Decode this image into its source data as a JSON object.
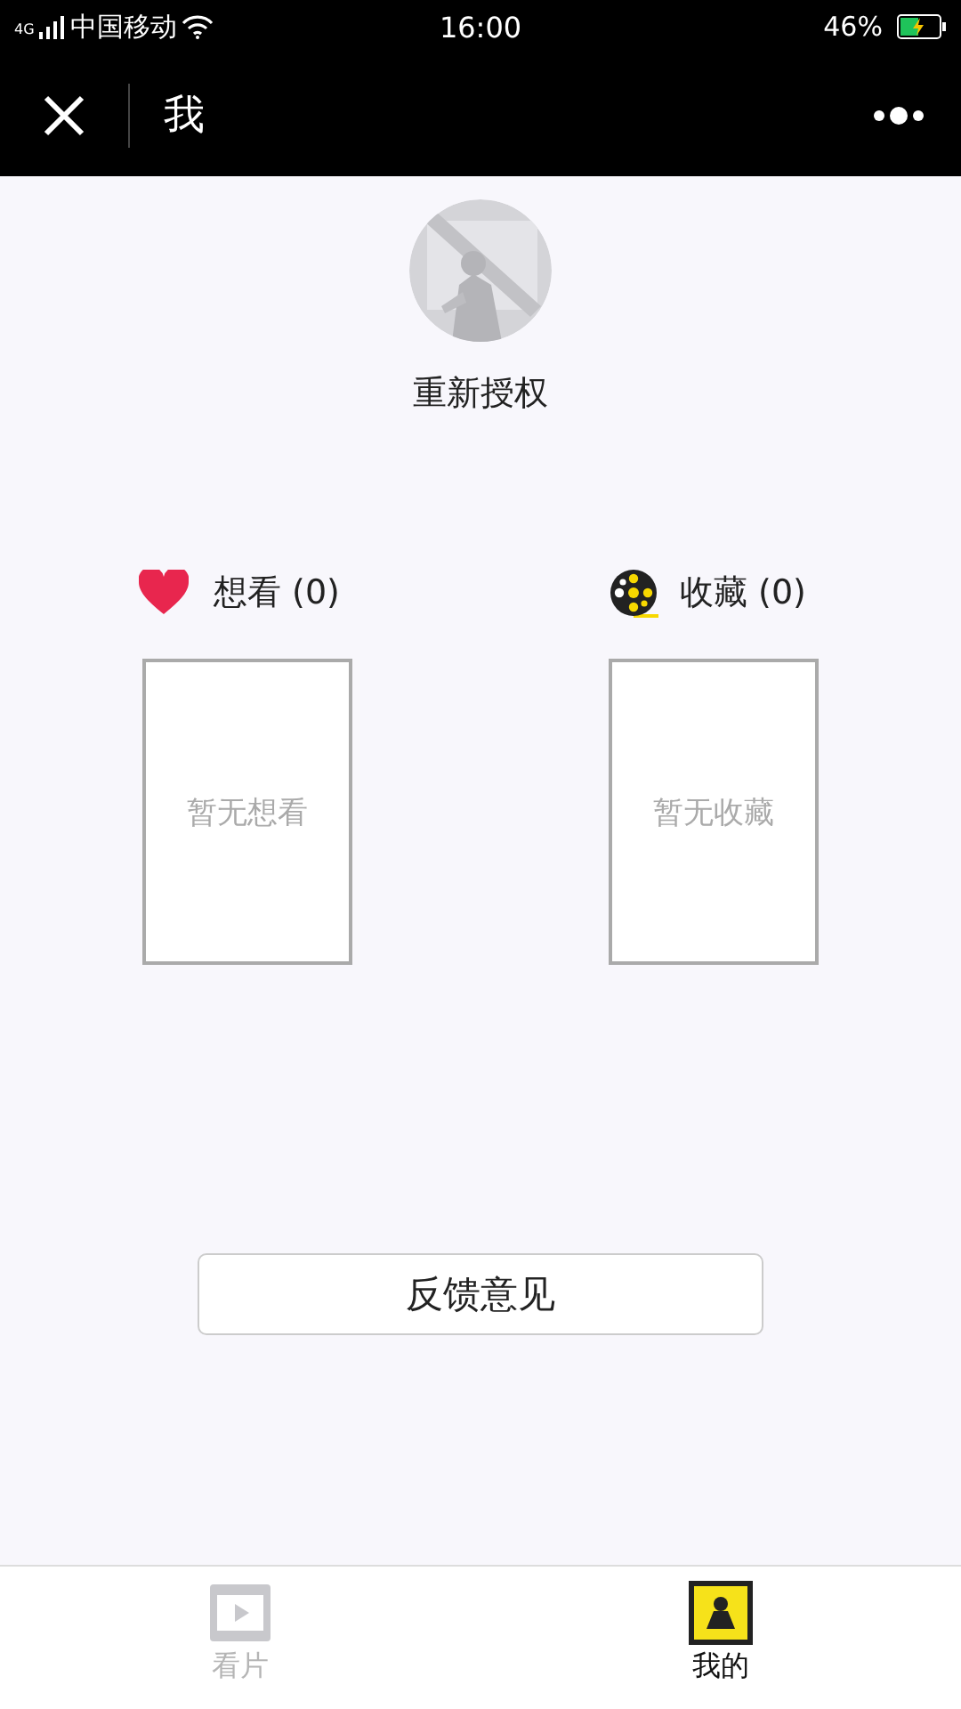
{
  "status_bar": {
    "network": "4G",
    "carrier": "中国移动",
    "time": "16:00",
    "battery": "46%",
    "charging": true
  },
  "nav": {
    "title": "我"
  },
  "profile": {
    "action": "重新授权"
  },
  "collections": [
    {
      "kind": "heart",
      "label": "想看 (0)",
      "empty_text": "暂无想看"
    },
    {
      "kind": "reel",
      "label": "收藏 (0)",
      "empty_text": "暂无收藏"
    }
  ],
  "feedback_button": "反馈意见",
  "tabs": [
    {
      "kind": "film",
      "label": "看片",
      "selected": false
    },
    {
      "kind": "mine",
      "label": "我的",
      "selected": true
    }
  ]
}
